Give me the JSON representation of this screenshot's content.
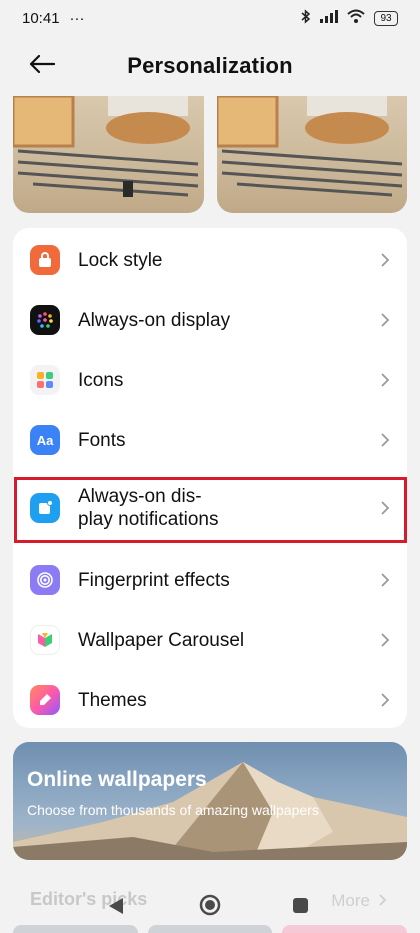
{
  "status_bar": {
    "time": "10:41",
    "more": "···",
    "battery": "93"
  },
  "header": {
    "title": "Personalization"
  },
  "settings": {
    "items": [
      {
        "label": "Lock style",
        "icon": "lock-icon",
        "color": "#f06a3c"
      },
      {
        "label": "Always-on display",
        "icon": "aod-dots-icon",
        "color": "#111111"
      },
      {
        "label": "Icons",
        "icon": "grid-icon",
        "color": "#f3f3f6"
      },
      {
        "label": "Fonts",
        "icon": "font-icon",
        "color": "#3b82f6"
      },
      {
        "label": "Always-on dis-\nplay notifications",
        "icon": "notification-icon",
        "color": "#1f9ff0"
      },
      {
        "label": "Fingerprint effects",
        "icon": "fingerprint-icon",
        "color": "#8b7cf6"
      },
      {
        "label": "Wallpaper Carousel",
        "icon": "carousel-icon",
        "color": "#ffffff"
      },
      {
        "label": "Themes",
        "icon": "brush-icon",
        "color": "#ff6f7f"
      }
    ]
  },
  "banner": {
    "title": "Online wallpapers",
    "subtitle": "Choose from thousands of amazing wallpapers"
  },
  "editors_picks": {
    "title": "Editor's picks",
    "more": "More"
  }
}
